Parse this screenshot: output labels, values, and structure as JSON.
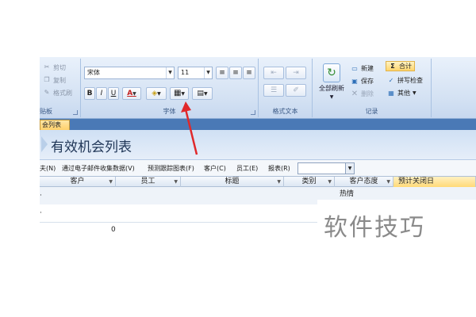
{
  "ribbon": {
    "clipboard": {
      "cut": "剪切",
      "copy": "复制",
      "format_painter": "格式刷",
      "label": "贴板"
    },
    "font": {
      "font_name": "宋体",
      "font_size": "11",
      "bold": "B",
      "italic": "I",
      "underline": "U",
      "font_color": "A",
      "label": "字体"
    },
    "rich_text": {
      "label": "格式文本"
    },
    "records": {
      "refresh_all": "全部刷新",
      "new": "新建",
      "save": "保存",
      "delete": "删除",
      "totals": "合计",
      "spelling": "拼写检查",
      "more": "其他",
      "label": "记录"
    }
  },
  "tab": {
    "label": "会列表"
  },
  "page_title": "有效机会列表",
  "links": {
    "l1": "夫(N)",
    "l2": "通过电子邮件收集数据(V)",
    "l3": "预测跟踪图表(F)",
    "l4": "客户(C)",
    "l5": "员工(E)",
    "l6": "报表(R)"
  },
  "grid": {
    "columns": [
      "客户",
      "员工",
      "标题",
      "类别",
      "客户态度",
      "预计关闭日"
    ],
    "rows": [
      {
        "attitude": "热情",
        "value": ""
      },
      {
        "attitude": "",
        "value": "0"
      }
    ]
  },
  "watermark": "软件技巧",
  "colors": {
    "ribbon": "#d3e1f3",
    "tab_strip": "#4a79b6",
    "highlight": "#ffd56c",
    "arrow": "#e0282a"
  }
}
